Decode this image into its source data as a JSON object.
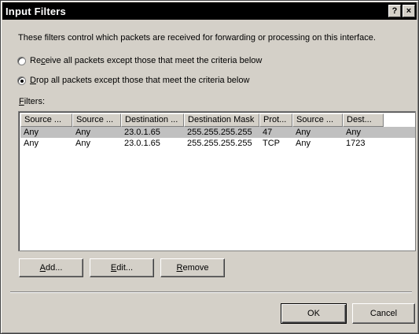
{
  "window": {
    "title": "Input Filters",
    "help_glyph": "?",
    "close_glyph": "×"
  },
  "description": "These filters control which packets are received for forwarding or processing on this interface.",
  "options": {
    "receive": {
      "prefix": "Re",
      "accel": "c",
      "rest": "eive all packets except those that meet the criteria below",
      "selected": false
    },
    "drop": {
      "prefix": "",
      "accel": "D",
      "rest": "rop all packets except those that meet the criteria below",
      "selected": true
    }
  },
  "filters_label": {
    "prefix": "",
    "accel": "F",
    "rest": "ilters:"
  },
  "table": {
    "columns": [
      "Source ...",
      "Source ...",
      "Destination ...",
      "Destination Mask",
      "Prot...",
      "Source ...",
      "Dest..."
    ],
    "rows": [
      [
        "Any",
        "Any",
        "23.0.1.65",
        "255.255.255.255",
        "47",
        "Any",
        "Any"
      ],
      [
        "Any",
        "Any",
        "23.0.1.65",
        "255.255.255.255",
        "TCP",
        "Any",
        "1723"
      ]
    ],
    "selected_row": 0
  },
  "buttons": {
    "add": {
      "accel": "A",
      "rest": "dd..."
    },
    "edit": {
      "accel": "E",
      "rest": "dit..."
    },
    "remove": {
      "accel": "R",
      "rest": "emove"
    },
    "ok": "OK",
    "cancel": "Cancel"
  }
}
